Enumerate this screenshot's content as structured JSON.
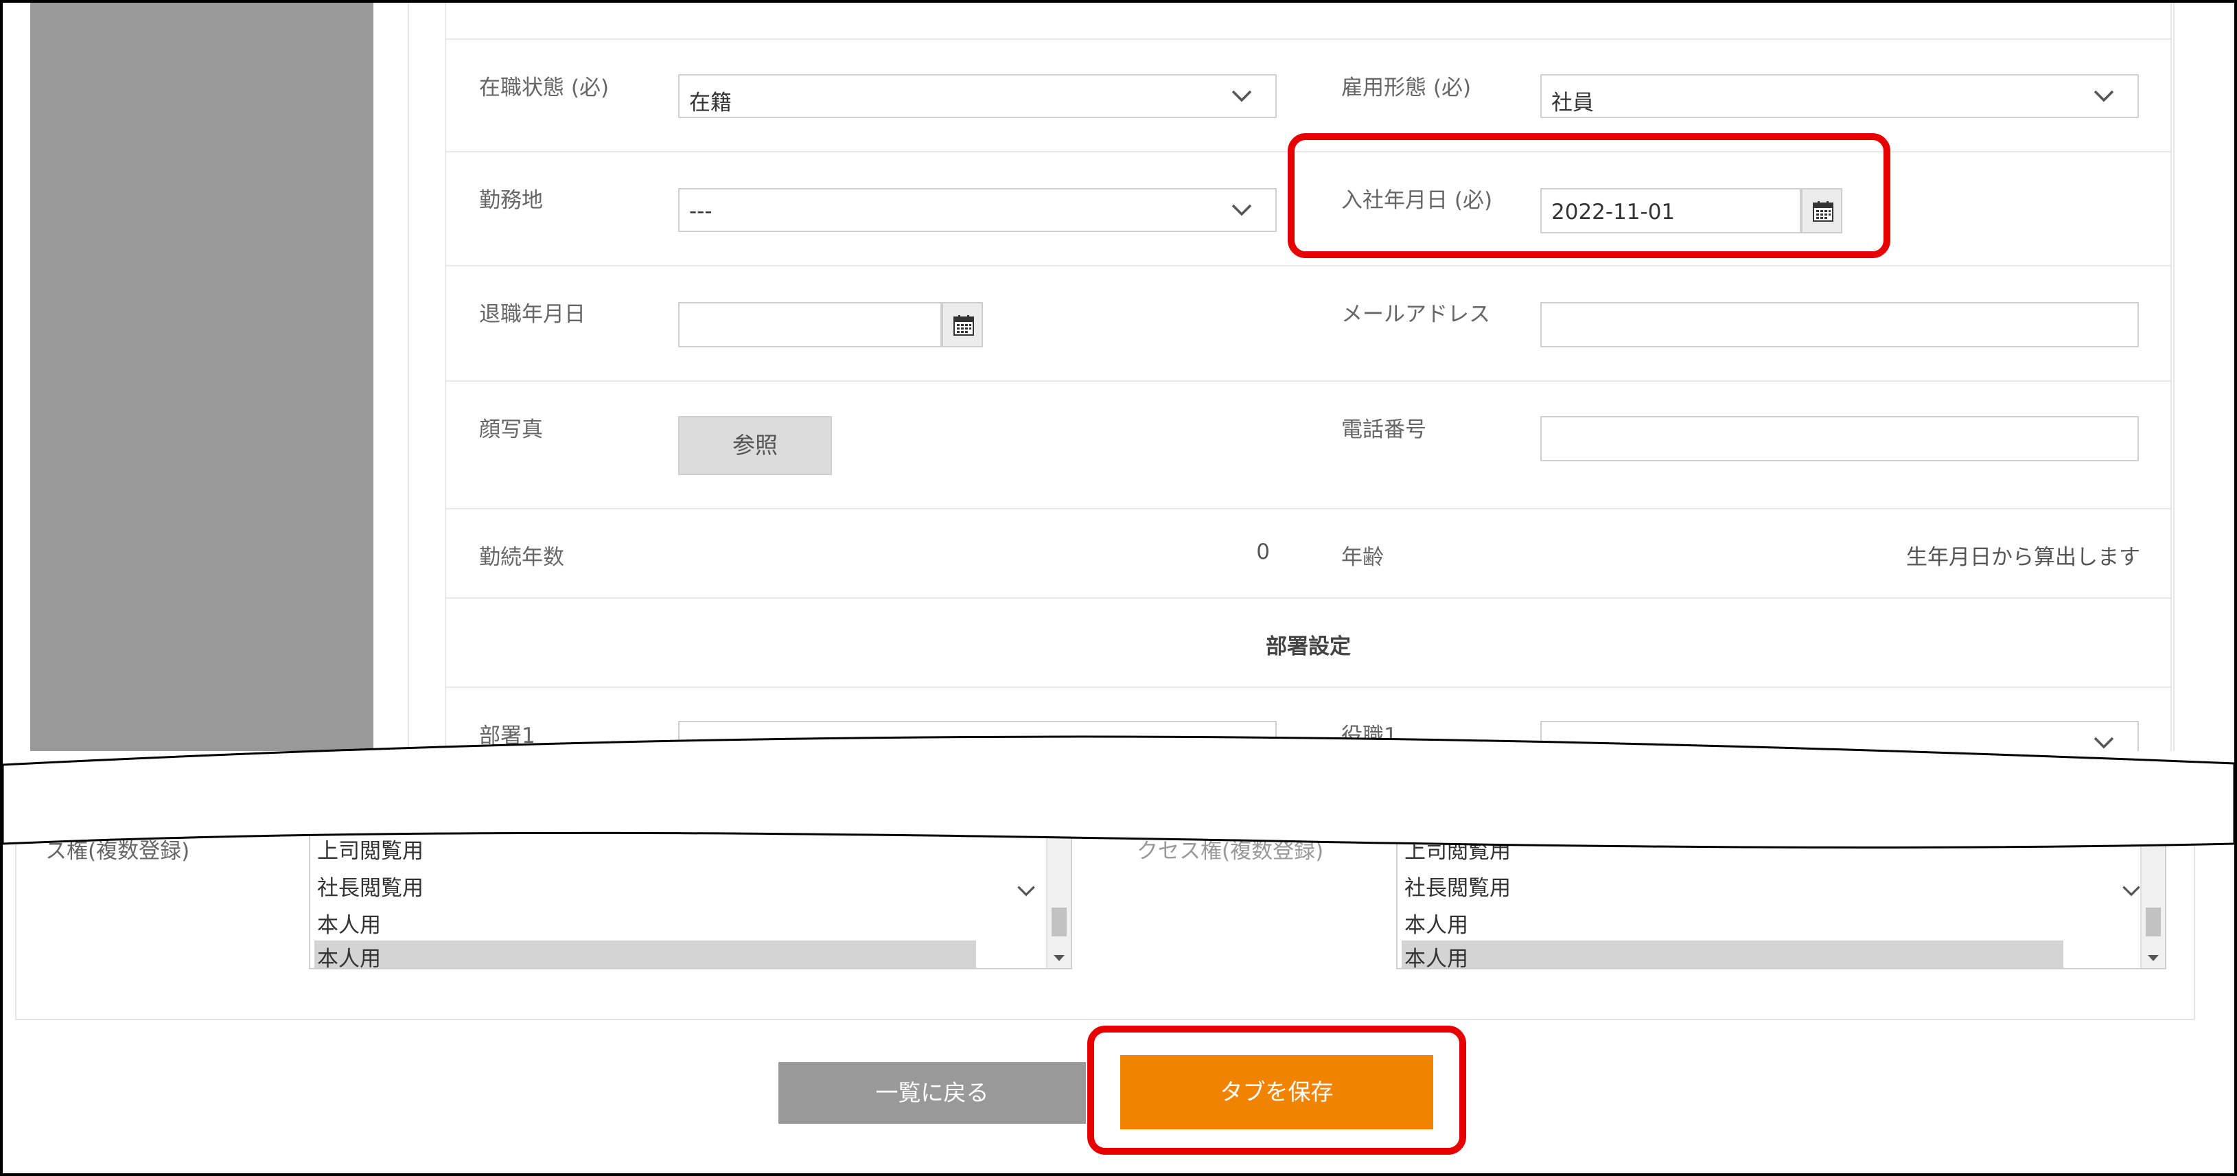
{
  "fields": {
    "status": {
      "label": "在職状態 (必)",
      "value": "在籍"
    },
    "employment_type": {
      "label": "雇用形態 (必)",
      "value": "社員"
    },
    "work_location": {
      "label": "勤務地",
      "value": "---"
    },
    "join_date": {
      "label": "入社年月日 (必)",
      "value": "2022-11-01"
    },
    "leave_date": {
      "label": "退職年月日",
      "value": ""
    },
    "email": {
      "label": "メールアドレス",
      "value": ""
    },
    "photo": {
      "label": "顔写真",
      "button": "参照"
    },
    "phone": {
      "label": "電話番号",
      "value": ""
    },
    "tenure": {
      "label": "勤続年数",
      "value": "0"
    },
    "age": {
      "label": "年齢",
      "value": "生年月日から算出します"
    }
  },
  "department_section": {
    "title": "部署設定",
    "department1": {
      "label": "部署1",
      "value": "---"
    },
    "position1": {
      "label": "役職1",
      "value": "---"
    }
  },
  "access": {
    "left_label": "ス権(複数登録)",
    "right_label": "クセス権(複数登録)",
    "left_options": [
      "上司閲覧用",
      "社長閲覧用",
      "本人用",
      "本人用"
    ],
    "right_options": [
      "上司閲覧用",
      "社長閲覧用",
      "本人用",
      "本人用"
    ],
    "selected_index": 3
  },
  "buttons": {
    "back": "一覧に戻る",
    "save": "タブを保存"
  },
  "colors": {
    "save_button": "#f08300",
    "back_button": "#999999",
    "highlight": "#e60000",
    "sidebar": "#999999"
  }
}
